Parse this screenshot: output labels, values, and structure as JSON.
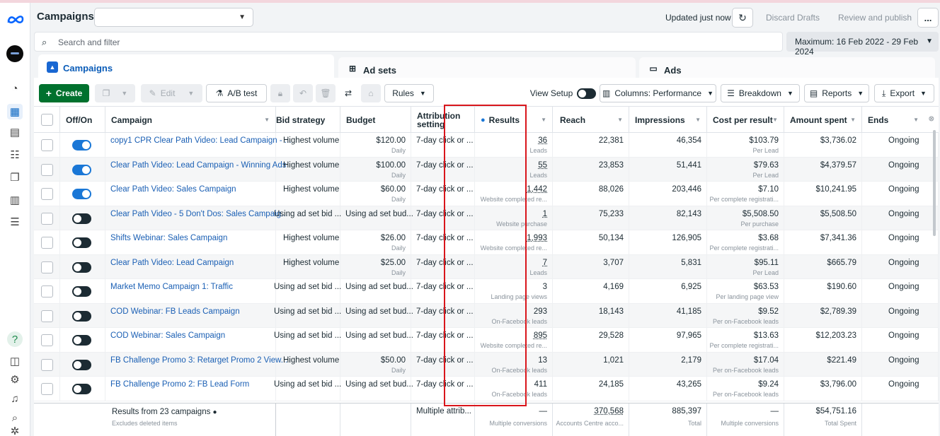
{
  "header": {
    "title": "Campaigns",
    "updated": "Updated just now",
    "discard": "Discard Drafts",
    "review": "Review and publish",
    "more": "..."
  },
  "search": {
    "placeholder": "Search and filter"
  },
  "date_range": "Maximum: 16 Feb 2022 - 29 Feb 2024",
  "tabs": [
    {
      "label": "Campaigns"
    },
    {
      "label": "Ad sets"
    },
    {
      "label": "Ads"
    }
  ],
  "toolbar": {
    "create": "Create",
    "edit": "Edit",
    "ab_test": "A/B test",
    "rules": "Rules",
    "view_setup": "View Setup",
    "columns": "Columns: Performance",
    "breakdown": "Breakdown",
    "reports": "Reports",
    "export": "Export"
  },
  "columns": [
    "Off/On",
    "Campaign",
    "Bid strategy",
    "Budget",
    "Attribution setting",
    "Results",
    "Reach",
    "Impressions",
    "Cost per result",
    "Amount spent",
    "Ends"
  ],
  "rows": [
    {
      "on": true,
      "campaign": "copy1 CPR Clear Path Video: Lead Campaign - ...",
      "bid": "Highest volume",
      "budget": "$120.00",
      "budget_sub": "Daily",
      "attribution": "7-day click or ...",
      "results": "36",
      "results_sub": "Leads",
      "reach": "22,381",
      "impressions": "46,354",
      "cpr": "$103.79",
      "cpr_sub": "Per Lead",
      "spent": "$3,736.02",
      "ends": "Ongoing"
    },
    {
      "on": true,
      "campaign": "Clear Path Video: Lead Campaign - Winning Ads",
      "bid": "Highest volume",
      "budget": "$100.00",
      "budget_sub": "Daily",
      "attribution": "7-day click or ...",
      "results": "55",
      "results_sub": "Leads",
      "reach": "23,853",
      "impressions": "51,441",
      "cpr": "$79.63",
      "cpr_sub": "Per Lead",
      "spent": "$4,379.57",
      "ends": "Ongoing"
    },
    {
      "on": true,
      "campaign": "Clear Path Video: Sales Campaign",
      "bid": "Highest volume",
      "budget": "$60.00",
      "budget_sub": "Daily",
      "attribution": "7-day click or ...",
      "results": "1,442",
      "results_sub": "Website completed re...",
      "reach": "88,026",
      "impressions": "203,446",
      "cpr": "$7.10",
      "cpr_sub": "Per complete registrati...",
      "spent": "$10,241.95",
      "ends": "Ongoing"
    },
    {
      "on": false,
      "campaign": "Clear Path Video - 5 Don't Dos: Sales Campaig...",
      "bid": "Using ad set bid ...",
      "budget": "Using ad set bud...",
      "budget_sub": "",
      "attribution": "7-day click or ...",
      "results": "1",
      "results_sub": "Website purchase",
      "reach": "75,233",
      "impressions": "82,143",
      "cpr": "$5,508.50",
      "cpr_sub": "Per purchase",
      "spent": "$5,508.50",
      "ends": "Ongoing"
    },
    {
      "on": false,
      "campaign": "Shifts Webinar: Sales Campaign",
      "bid": "Highest volume",
      "budget": "$26.00",
      "budget_sub": "Daily",
      "attribution": "7-day click or ...",
      "results": "1,993",
      "results_sub": "Website completed re...",
      "reach": "50,134",
      "impressions": "126,905",
      "cpr": "$3.68",
      "cpr_sub": "Per complete registrati...",
      "spent": "$7,341.36",
      "ends": "Ongoing"
    },
    {
      "on": false,
      "campaign": "Clear Path Video: Lead Campaign",
      "bid": "Highest volume",
      "budget": "$25.00",
      "budget_sub": "Daily",
      "attribution": "7-day click or ...",
      "results": "7",
      "results_sub": "Leads",
      "reach": "3,707",
      "impressions": "5,831",
      "cpr": "$95.11",
      "cpr_sub": "Per Lead",
      "spent": "$665.79",
      "ends": "Ongoing"
    },
    {
      "on": false,
      "campaign": "Market Memo Campaign 1: Traffic",
      "bid": "Using ad set bid ...",
      "budget": "Using ad set bud...",
      "budget_sub": "",
      "attribution": "7-day click or ...",
      "results": "3",
      "results_sub": "Landing page views",
      "reach": "4,169",
      "impressions": "6,925",
      "cpr": "$63.53",
      "cpr_sub": "Per landing page view",
      "spent": "$190.60",
      "ends": "Ongoing"
    },
    {
      "on": false,
      "campaign": "COD Webinar: FB Leads Campaign",
      "bid": "Using ad set bid ...",
      "budget": "Using ad set bud...",
      "budget_sub": "",
      "attribution": "7-day click or ...",
      "results": "293",
      "results_sub": "On-Facebook leads",
      "reach": "18,143",
      "impressions": "41,185",
      "cpr": "$9.52",
      "cpr_sub": "Per on-Facebook leads",
      "spent": "$2,789.39",
      "ends": "Ongoing"
    },
    {
      "on": false,
      "campaign": "COD Webinar: Sales Campaign",
      "bid": "Using ad set bid ...",
      "budget": "Using ad set bud...",
      "budget_sub": "",
      "attribution": "7-day click or ...",
      "results": "895",
      "results_sub": "Website completed re...",
      "reach": "29,528",
      "impressions": "97,965",
      "cpr": "$13.63",
      "cpr_sub": "Per complete registrati...",
      "spent": "$12,203.23",
      "ends": "Ongoing"
    },
    {
      "on": false,
      "campaign": "FB Challenge Promo 3: Retarget Promo 2 View...",
      "bid": "Highest volume",
      "budget": "$50.00",
      "budget_sub": "Daily",
      "attribution": "7-day click or ...",
      "results": "13",
      "results_sub": "On-Facebook leads",
      "reach": "1,021",
      "impressions": "2,179",
      "cpr": "$17.04",
      "cpr_sub": "Per on-Facebook leads",
      "spent": "$221.49",
      "ends": "Ongoing"
    },
    {
      "on": false,
      "campaign": "FB Challenge Promo 2: FB Lead Form",
      "bid": "Using ad set bid ...",
      "budget": "Using ad set bud...",
      "budget_sub": "",
      "attribution": "7-day click or ...",
      "results": "411",
      "results_sub": "On-Facebook leads",
      "reach": "24,185",
      "impressions": "43,265",
      "cpr": "$9.24",
      "cpr_sub": "Per on-Facebook leads",
      "spent": "$3,796.00",
      "ends": "Ongoing"
    }
  ],
  "footer": {
    "label": "Results from 23 campaigns",
    "sub": "Excludes deleted items",
    "attribution": "Multiple attrib...",
    "results": "—",
    "results_sub": "Multiple conversions",
    "reach": "370,568",
    "reach_sub": "Accounts Centre acco...",
    "impressions": "885,397",
    "impressions_sub": "Total",
    "cpr": "—",
    "cpr_sub": "Multiple conversions",
    "spent": "$54,751.16",
    "spent_sub": "Total Spent"
  },
  "colors": {
    "accent": "#1a77d6",
    "create": "#00712e",
    "highlight": "#d9161c"
  }
}
